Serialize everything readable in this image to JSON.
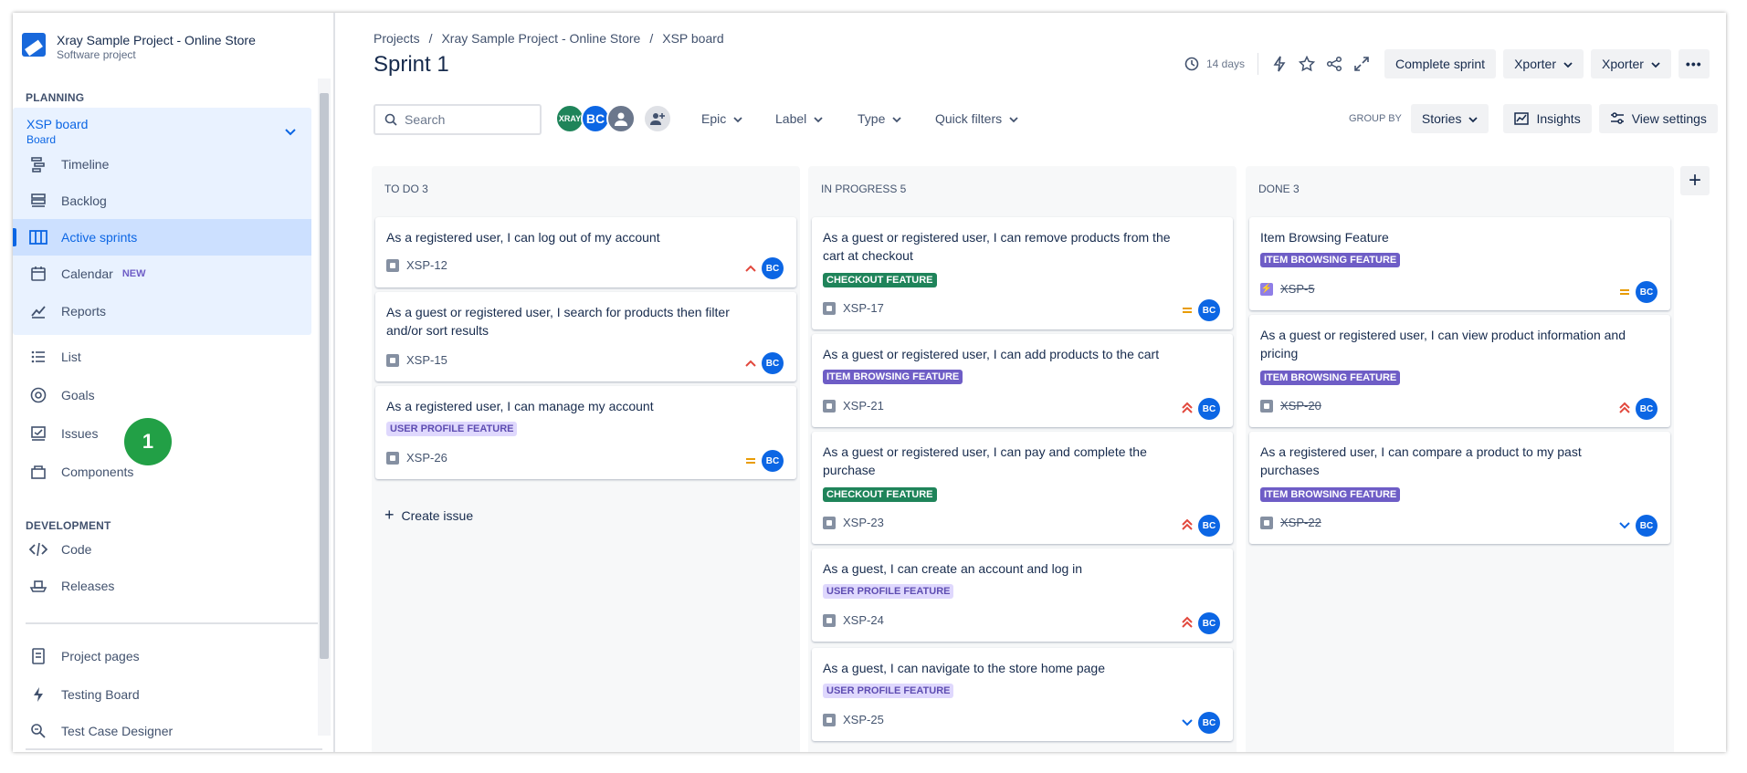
{
  "project": {
    "name": "Xray Sample Project - Online Store",
    "type": "Software project"
  },
  "sidebar": {
    "planning_heading": "PLANNING",
    "board": {
      "name": "XSP board",
      "sub": "Board"
    },
    "planning_items": [
      {
        "label": "Timeline",
        "icon": "timeline-icon"
      },
      {
        "label": "Backlog",
        "icon": "backlog-icon"
      },
      {
        "label": "Active sprints",
        "icon": "board-icon"
      },
      {
        "label": "Calendar",
        "icon": "calendar-icon",
        "badge": "NEW"
      },
      {
        "label": "Reports",
        "icon": "chart-icon"
      }
    ],
    "other_items": [
      {
        "label": "List",
        "icon": "list-icon"
      },
      {
        "label": "Goals",
        "icon": "target-icon"
      },
      {
        "label": "Issues",
        "icon": "issues-icon"
      },
      {
        "label": "Components",
        "icon": "components-icon"
      }
    ],
    "development_heading": "DEVELOPMENT",
    "dev_items": [
      {
        "label": "Code",
        "icon": "code-icon"
      },
      {
        "label": "Releases",
        "icon": "ship-icon"
      }
    ],
    "extra_items": [
      {
        "label": "Project pages",
        "icon": "page-icon"
      },
      {
        "label": "Testing Board",
        "icon": "bolt-icon"
      },
      {
        "label": "Test Case Designer",
        "icon": "designer-icon"
      }
    ],
    "step_badge": "1"
  },
  "breadcrumb": [
    "Projects",
    "Xray Sample Project - Online Store",
    "XSP board"
  ],
  "page_title": "Sprint 1",
  "header": {
    "days": "14 days",
    "complete_sprint": "Complete sprint",
    "xporter1": "Xporter",
    "xporter2": "Xporter"
  },
  "toolbar": {
    "search_placeholder": "Search",
    "avatars": [
      "XRAY",
      "BC"
    ],
    "filters": [
      "Epic",
      "Label",
      "Type",
      "Quick filters"
    ],
    "group_by_label": "GROUP BY",
    "group_by_value": "Stories",
    "insights": "Insights",
    "view_settings": "View settings"
  },
  "columns": [
    {
      "title": "TO DO 3",
      "create_issue": "Create issue",
      "cards": [
        {
          "summary": "As a registered user, I can log out of my account",
          "key": "XSP-12",
          "priority": "medium",
          "assignee": "BC"
        },
        {
          "summary": "As a guest or registered user, I search for products then filter and/or sort results",
          "key": "XSP-15",
          "priority": "medium",
          "assignee": "BC"
        },
        {
          "summary": "As a registered user, I can manage my account",
          "label": "USER PROFILE FEATURE",
          "key": "XSP-26",
          "priority": "equal",
          "assignee": "BC"
        }
      ]
    },
    {
      "title": "IN PROGRESS 5",
      "cards": [
        {
          "summary": "As a guest or registered user, I can remove products from the cart at checkout",
          "label": "CHECKOUT FEATURE",
          "key": "XSP-17",
          "priority": "equal",
          "assignee": "BC"
        },
        {
          "summary": "As a guest or registered user, I can add products to the cart",
          "label": "ITEM BROWSING FEATURE",
          "key": "XSP-21",
          "priority": "high",
          "assignee": "BC"
        },
        {
          "summary": "As a guest or registered user, I can pay and complete the purchase",
          "label": "CHECKOUT FEATURE",
          "key": "XSP-23",
          "priority": "high",
          "assignee": "BC"
        },
        {
          "summary": "As a guest, I can create an account and log in",
          "label": "USER PROFILE FEATURE",
          "key": "XSP-24",
          "priority": "high",
          "assignee": "BC"
        },
        {
          "summary": "As a guest, I can navigate to the store home page",
          "label": "USER PROFILE FEATURE",
          "key": "XSP-25",
          "priority": "low",
          "assignee": "BC"
        }
      ]
    },
    {
      "title": "DONE 3",
      "cards": [
        {
          "summary": "Item Browsing Feature",
          "label": "ITEM BROWSING FEATURE",
          "key": "XSP-5",
          "priority": "equal",
          "assignee": "BC"
        },
        {
          "summary": "As a guest or registered user, I can view product information and pricing",
          "label": "ITEM BROWSING FEATURE",
          "key": "XSP-20",
          "priority": "high",
          "assignee": "BC"
        },
        {
          "summary": "As a registered user, I can compare a product to my past purchases",
          "label": "ITEM BROWSING FEATURE",
          "key": "XSP-22",
          "priority": "low",
          "assignee": "BC"
        }
      ]
    }
  ]
}
